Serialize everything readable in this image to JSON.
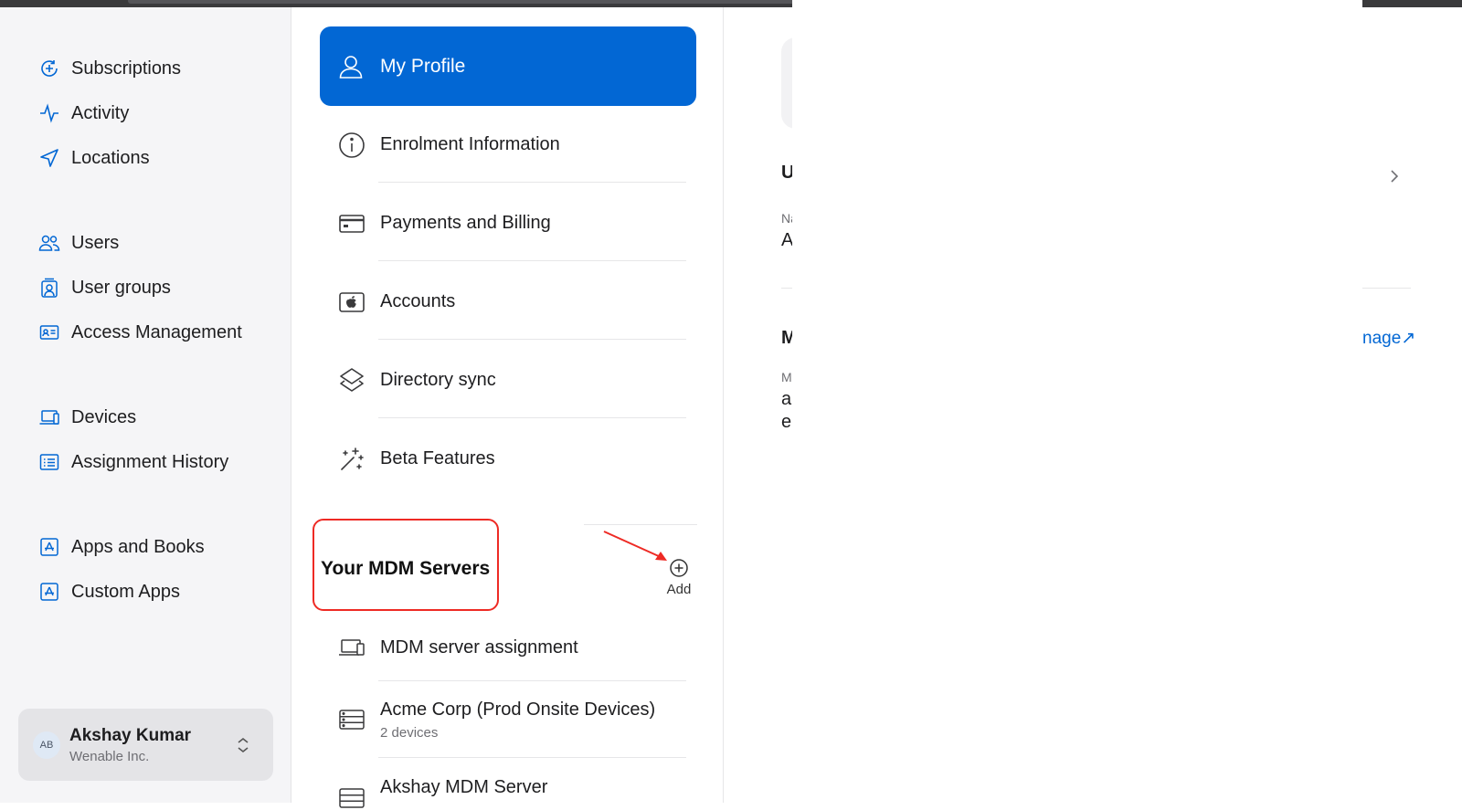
{
  "sidebar": {
    "groups": [
      [
        {
          "label": "Subscriptions",
          "icon": "subscriptions-icon"
        },
        {
          "label": "Activity",
          "icon": "activity-icon"
        },
        {
          "label": "Locations",
          "icon": "location-arrow-icon"
        }
      ],
      [
        {
          "label": "Users",
          "icon": "users-icon"
        },
        {
          "label": "User groups",
          "icon": "user-groups-icon"
        },
        {
          "label": "Access Management",
          "icon": "id-card-icon"
        }
      ],
      [
        {
          "label": "Devices",
          "icon": "laptop-icon"
        },
        {
          "label": "Assignment History",
          "icon": "list-icon"
        }
      ],
      [
        {
          "label": "Apps and Books",
          "icon": "app-store-icon"
        },
        {
          "label": "Custom Apps",
          "icon": "app-store-icon"
        }
      ]
    ],
    "account": {
      "initials": "AB",
      "name": "Akshay Kumar",
      "org": "Wenable Inc."
    }
  },
  "preferences": {
    "selected": "My Profile",
    "items": [
      {
        "label": "My Profile",
        "icon": "person-icon"
      },
      {
        "label": "Enrolment Information",
        "icon": "info-icon"
      },
      {
        "label": "Payments and Billing",
        "icon": "credit-card-icon"
      },
      {
        "label": "Accounts",
        "icon": "apple-account-icon"
      },
      {
        "label": "Directory sync",
        "icon": "directory-sync-icon"
      },
      {
        "label": "Beta Features",
        "icon": "sparkles-icon"
      }
    ]
  },
  "mdm": {
    "section_title": "Your MDM Servers",
    "add_label": "Add",
    "servers": [
      {
        "label": "MDM server assignment",
        "sub": ""
      },
      {
        "label": "Acme Corp (Prod Onsite Devices)",
        "sub": "2 devices"
      },
      {
        "label": "Akshay MDM Server",
        "sub": ""
      }
    ]
  },
  "detail": {
    "fragments": {
      "heading1": "U",
      "label1": "Na",
      "value1": "A",
      "heading2": "M",
      "label2": "M",
      "value2a": "al",
      "value2b": "er"
    },
    "manage_link": "nage↗"
  },
  "colors": {
    "accent": "#0267d4",
    "highlight": "#ee2a24"
  }
}
